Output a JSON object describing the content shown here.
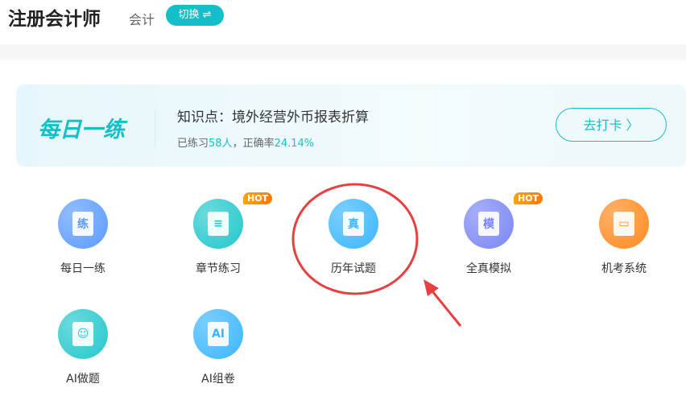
{
  "header": {
    "title": "注册会计师",
    "subject": "会计",
    "switch_label": "切换 ⇌"
  },
  "banner": {
    "logo_text": "每日一练",
    "topic": "知识点：境外经营外币报表折算",
    "stats_prefix": "已练习",
    "count": "58人",
    "stats_mid": "，正确率",
    "rate": "24.14%",
    "button": "去打卡 〉"
  },
  "hot_badge": "HOT",
  "items": [
    {
      "label": "每日一练",
      "glyph": "练",
      "color": "#5a9bff"
    },
    {
      "label": "章节练习",
      "glyph": "≡",
      "color": "#22c8cc",
      "hot": true
    },
    {
      "label": "历年试题",
      "glyph": "真",
      "color": "#3bb6ff"
    },
    {
      "label": "全真模拟",
      "glyph": "模",
      "color": "#7a86f5",
      "hot": true
    },
    {
      "label": "机考系统",
      "glyph": "▭",
      "color": "#ff8a1f"
    },
    {
      "label": "AI做题",
      "glyph": "☺",
      "color": "#22c8cc"
    },
    {
      "label": "AI组卷",
      "glyph": "AI",
      "color": "#3bb6ff"
    }
  ]
}
